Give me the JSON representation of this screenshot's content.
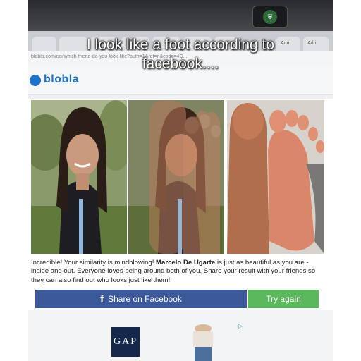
{
  "caption": "I look like a foot according to facebook....",
  "browser": {
    "url": "blobla.com/cai/which-friend-do-you-look-like?auth=1&ref=n&code=4Q...",
    "tabs": [
      "Adri",
      "Adri"
    ]
  },
  "site": {
    "logo": "blobla"
  },
  "result": {
    "text_intro": "Incredible! Your similarity is mindblowing! ",
    "name": "Marcelo De Ugarte",
    "text_rest": " is just as beautiful as you are - inside and out. Everyone loves being around both of you. Share your result with your friends so they can also find out who looks just like them!"
  },
  "buttons": {
    "share": "Share on Facebook",
    "retry": "Try again"
  },
  "ad": {
    "brand": "GAP"
  },
  "colors": {
    "facebook_blue": "#3b5998",
    "retry_green": "#5cb85c",
    "logo_blue": "#1e73c8"
  }
}
